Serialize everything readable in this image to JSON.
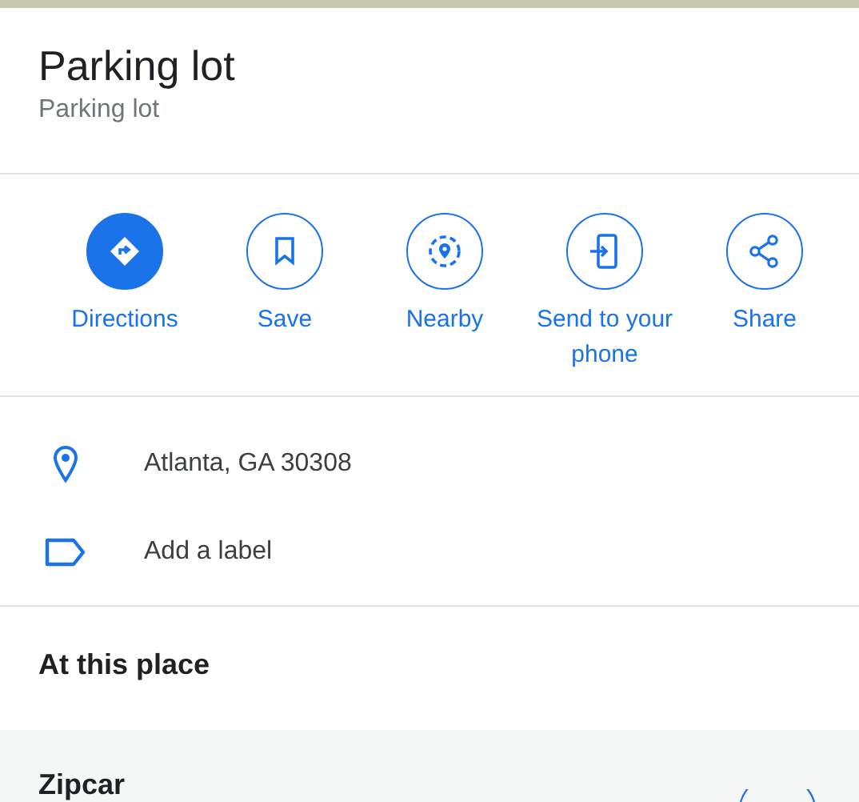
{
  "place": {
    "title": "Parking lot",
    "category": "Parking lot"
  },
  "actions": [
    {
      "label": "Directions",
      "kind": "filled"
    },
    {
      "label": "Save",
      "kind": "outlined"
    },
    {
      "label": "Nearby",
      "kind": "outlined"
    },
    {
      "label": "Send to your phone",
      "kind": "outlined"
    },
    {
      "label": "Share",
      "kind": "outlined"
    }
  ],
  "info_rows": [
    {
      "text": "Atlanta, GA 30308"
    },
    {
      "text": "Add a label"
    }
  ],
  "section": {
    "heading": "At this place"
  },
  "places": [
    {
      "name": "Zipcar"
    }
  ]
}
